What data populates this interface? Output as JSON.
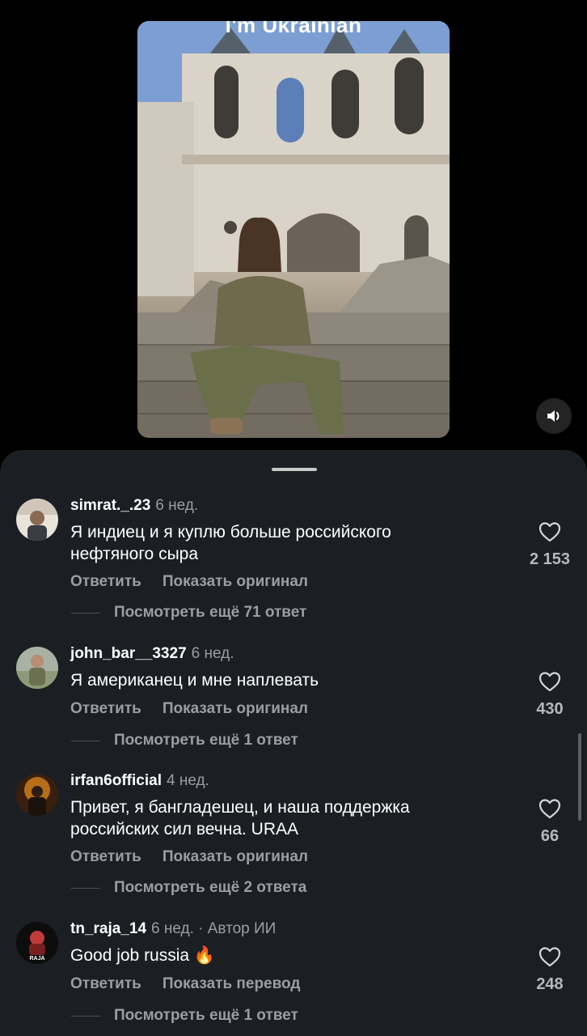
{
  "video": {
    "caption": "I'm Ukrainian"
  },
  "icons": {
    "sound": "speaker-icon",
    "like": "heart-icon"
  },
  "comments": [
    {
      "user": "simrat._.23",
      "time": "6 нед.",
      "author_tag": "",
      "text": "Я индиец и я куплю больше российского нефтяного сыра",
      "reply": "Ответить",
      "secondary": "Показать оригинал",
      "likes": "2 153",
      "more": "Посмотреть ещё 71 ответ"
    },
    {
      "user": "john_bar__3327",
      "time": "6 нед.",
      "author_tag": "",
      "text": "Я американец и мне наплевать",
      "reply": "Ответить",
      "secondary": "Показать оригинал",
      "likes": "430",
      "more": "Посмотреть ещё 1 ответ"
    },
    {
      "user": "irfan6official",
      "time": "4 нед.",
      "author_tag": "",
      "text": "Привет, я бангладешец, и наша поддержка российских сил вечна. URAA",
      "reply": "Ответить",
      "secondary": "Показать оригинал",
      "likes": "66",
      "more": "Посмотреть ещё 2 ответа"
    },
    {
      "user": "tn_raja_14",
      "time": "6 нед.",
      "author_tag": "· Автор ИИ",
      "text": "Good job russia 🔥",
      "reply": "Ответить",
      "secondary": "Показать перевод",
      "likes": "248",
      "more": "Посмотреть ещё 1 ответ",
      "avatar_label": "RAJA"
    }
  ]
}
